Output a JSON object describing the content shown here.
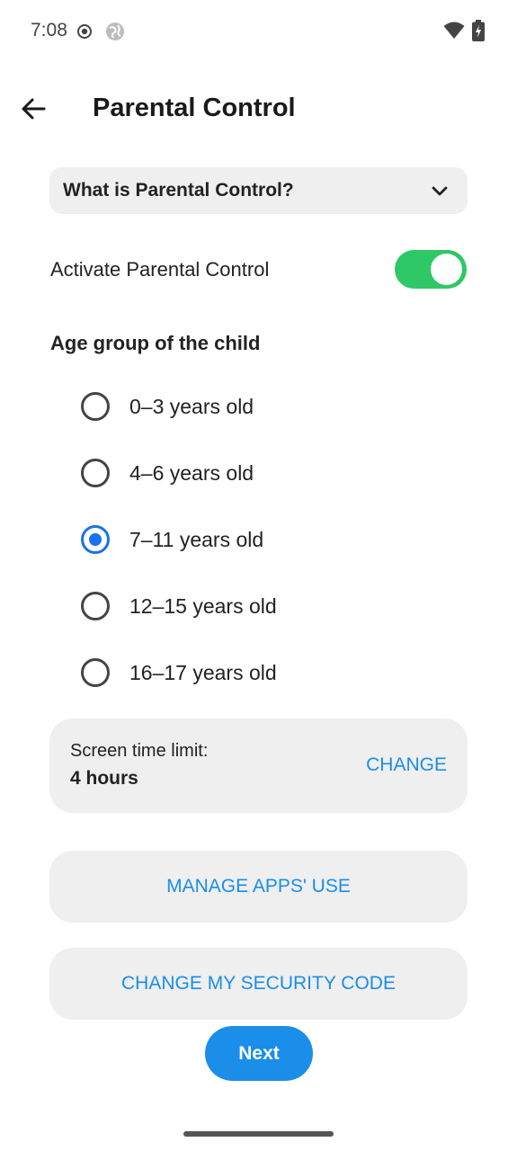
{
  "status_bar": {
    "time": "7:08",
    "icons": [
      "record-icon",
      "globe-icon",
      "wifi-icon",
      "battery-icon"
    ]
  },
  "app_bar": {
    "title": "Parental Control",
    "back_icon": "arrow-left-icon"
  },
  "faq": {
    "label": "What is Parental Control?",
    "icon": "chevron-down-icon"
  },
  "activation": {
    "label": "Activate Parental Control",
    "enabled": true,
    "accent_color": "#2ec866"
  },
  "age_group": {
    "title": "Age group of the child",
    "options": [
      {
        "label": "0–3 years old",
        "selected": false
      },
      {
        "label": "4–6 years old",
        "selected": false
      },
      {
        "label": "7–11 years old",
        "selected": true
      },
      {
        "label": "12–15 years old",
        "selected": false
      },
      {
        "label": "16–17 years old",
        "selected": false
      }
    ]
  },
  "screen_time": {
    "label": "Screen time limit:",
    "value": "4 hours",
    "change_label": "CHANGE"
  },
  "actions": {
    "manage_apps_label": "MANAGE APPS' USE",
    "change_code_label": "CHANGE MY SECURITY CODE",
    "next_label": "Next"
  },
  "colors": {
    "primary": "#1a8ee8",
    "radio_selected": "#1a73e8",
    "card_bg": "#efefef"
  }
}
